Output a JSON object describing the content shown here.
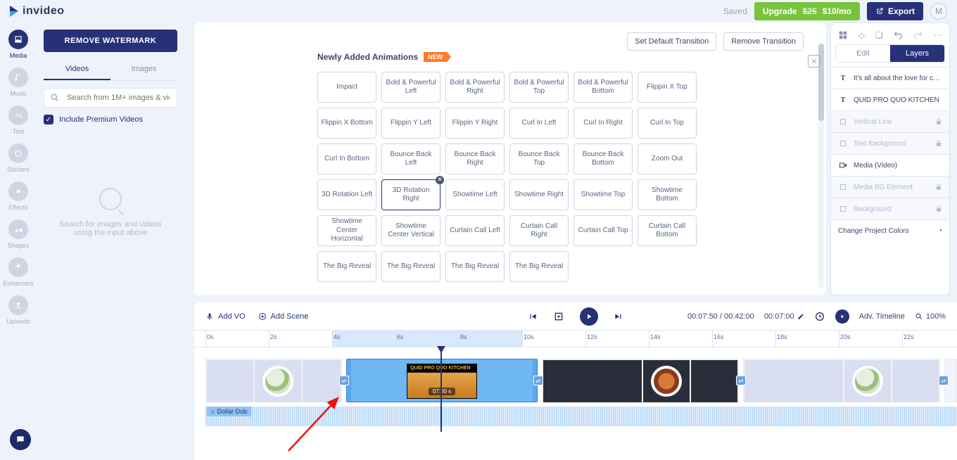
{
  "top": {
    "brand": "invideo",
    "saved": "Saved",
    "upgrade_pre": "Upgrade ",
    "upgrade_strike": "$25",
    "upgrade_post": " $10/mo",
    "export": "Export",
    "avatar_initial": "M"
  },
  "rail": {
    "items": [
      {
        "key": "media",
        "label": "Media"
      },
      {
        "key": "music",
        "label": "Music"
      },
      {
        "key": "text",
        "label": "Text"
      },
      {
        "key": "stickers",
        "label": "Stickers"
      },
      {
        "key": "effects",
        "label": "Effects"
      },
      {
        "key": "shapes",
        "label": "Shapes"
      },
      {
        "key": "enhancers",
        "label": "Enhancers"
      },
      {
        "key": "uploads",
        "label": "Uploads"
      }
    ]
  },
  "sidepanel": {
    "remove_wm": "REMOVE WATERMARK",
    "tab_videos": "Videos",
    "tab_images": "Images",
    "search_placeholder": "Search from 1M+ images & videos",
    "include_premium": "Include Premium Videos",
    "empty_l1": "Search for images and videos",
    "empty_l2": "using the input above"
  },
  "center": {
    "set_default": "Set Default Transition",
    "remove_trans": "Remove Transition",
    "section_title": "Newly Added Animations",
    "new_badge": "NEW",
    "animations": [
      "Impact",
      "Bold & Powerful Left",
      "Bold & Powerful Right",
      "Bold & Powerful Top",
      "Bold & Powerful Bottom",
      "Flippin X Top",
      "",
      "Flippin X Bottom",
      "Flippin Y Left",
      "Flippin Y Right",
      "Curl In Left",
      "Curl In Right",
      "Curl In Top",
      "",
      "Curl In Bottom",
      "Bounce Back Left",
      "Bounce Back Right",
      "Bounce Back Top",
      "Bounce Back Bottom",
      "Zoom Out",
      "",
      "3D Rotation Left",
      "3D Rotation Right",
      "Showtime Left",
      "Showtime Right",
      "Showtime Top",
      "Showtime Bottom",
      "",
      "Showtime Center Horizontal",
      "Showtime Center Vertical",
      "Curtain Call Left",
      "Curtain Call Right",
      "Curtain Call Top",
      "Curtain Call Bottom",
      "",
      "The Big Reveal",
      "The Big Reveal",
      "The Big Reveal",
      "The Big Reveal",
      "",
      "",
      ""
    ],
    "selected_index": 22
  },
  "right": {
    "tab_edit": "Edit",
    "tab_layers": "Layers",
    "layers": [
      {
        "label": "It's all about the love for co...",
        "ic": "T",
        "locked": false
      },
      {
        "label": "QUID PRO QUO KITCHEN",
        "ic": "T",
        "locked": false
      },
      {
        "label": "Vertical Line",
        "ic": "sq",
        "locked": true
      },
      {
        "label": "Text Background",
        "ic": "sq",
        "locked": true
      },
      {
        "label": "Media (Video)",
        "ic": "vid",
        "locked": false
      },
      {
        "label": "Media BG Element",
        "ic": "sq",
        "locked": true
      },
      {
        "label": "Background",
        "ic": "sq",
        "locked": true
      }
    ],
    "change_colors": "Change Project Colors"
  },
  "timeline": {
    "add_vo": "Add VO",
    "add_scene": "Add Scene",
    "time_cur": "00:07:50",
    "time_total": "00:42:00",
    "time_right": "00:07:00",
    "adv": "Adv. Timeline",
    "zoom": "100%",
    "ruler": [
      "0s",
      "2s",
      "4s",
      "6s",
      "8s",
      "10s",
      "12s",
      "14s",
      "16s",
      "18s",
      "20s",
      "22s"
    ],
    "audio_name": "Dollar Dub",
    "clip_title": "QUID PRO QUO KITCHEN",
    "clip_dur": "07:00 s"
  },
  "colors": {
    "navy": "#273178"
  }
}
